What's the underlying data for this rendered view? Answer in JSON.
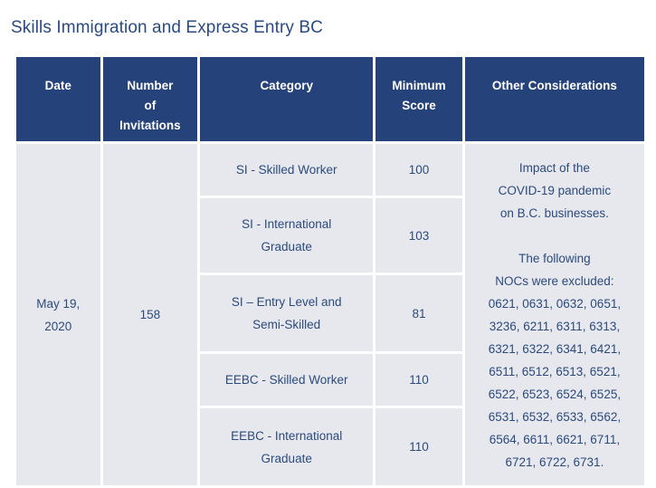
{
  "page": {
    "title": "Skills Immigration and Express Entry BC"
  },
  "colors": {
    "header_bg": "#25427a",
    "header_text": "#ffffff",
    "cell_bg": "#e6e8ee",
    "cell_text": "#2c4a7c",
    "title_text": "#2b4b80",
    "page_bg": "#ffffff"
  },
  "table": {
    "headers": [
      "Date",
      "Number of Invitations",
      "Category",
      "Minimum Score",
      "Other Considerations"
    ],
    "header_lines": {
      "date": [
        "Date"
      ],
      "invitations": [
        "Number",
        "of",
        "Invitations"
      ],
      "category": [
        "Category"
      ],
      "score": [
        "Minimum",
        "Score"
      ],
      "other": [
        "Other Considerations"
      ]
    },
    "date": "May 19, 2020",
    "date_lines": [
      "May 19,",
      "2020"
    ],
    "number_of_invitations": "158",
    "rows": [
      {
        "category": "SI - Skilled Worker",
        "category_lines": [
          "SI - Skilled Worker"
        ],
        "minimum_score": "100"
      },
      {
        "category": "SI - International Graduate",
        "category_lines": [
          "SI - International",
          "Graduate"
        ],
        "minimum_score": "103"
      },
      {
        "category": "SI – Entry Level and Semi-Skilled",
        "category_lines": [
          "SI – Entry Level and",
          "Semi-Skilled"
        ],
        "minimum_score": "81"
      },
      {
        "category": "EEBC - Skilled Worker",
        "category_lines": [
          "EEBC - Skilled Worker"
        ],
        "minimum_score": "110"
      },
      {
        "category": "EEBC - International Graduate",
        "category_lines": [
          "EEBC - International",
          "Graduate"
        ],
        "minimum_score": "110"
      }
    ],
    "other_considerations": {
      "paragraph_1": "Impact of the COVID-19 pandemic on B.C. businesses.",
      "paragraph_1_lines": [
        "Impact of the",
        "COVID-19 pandemic",
        "on B.C. businesses."
      ],
      "paragraph_2_intro_lines": [
        "The following",
        "NOCs were excluded:"
      ],
      "noc_lines": [
        "0621, 0631, 0632, 0651,",
        "3236, 6211, 6311, 6313,",
        "6321, 6322, 6341, 6421,",
        "6511, 6512, 6513, 6521,",
        "6522, 6523, 6524, 6525,",
        "6531, 6532, 6533, 6562,",
        "6564, 6611, 6621, 6711,",
        "6721, 6722, 6731."
      ],
      "noc_codes": [
        "0621",
        "0631",
        "0632",
        "0651",
        "3236",
        "6211",
        "6311",
        "6313",
        "6321",
        "6322",
        "6341",
        "6421",
        "6511",
        "6512",
        "6513",
        "6521",
        "6522",
        "6523",
        "6524",
        "6525",
        "6531",
        "6532",
        "6533",
        "6562",
        "6564",
        "6611",
        "6621",
        "6711",
        "6721",
        "6722",
        "6731"
      ]
    }
  }
}
